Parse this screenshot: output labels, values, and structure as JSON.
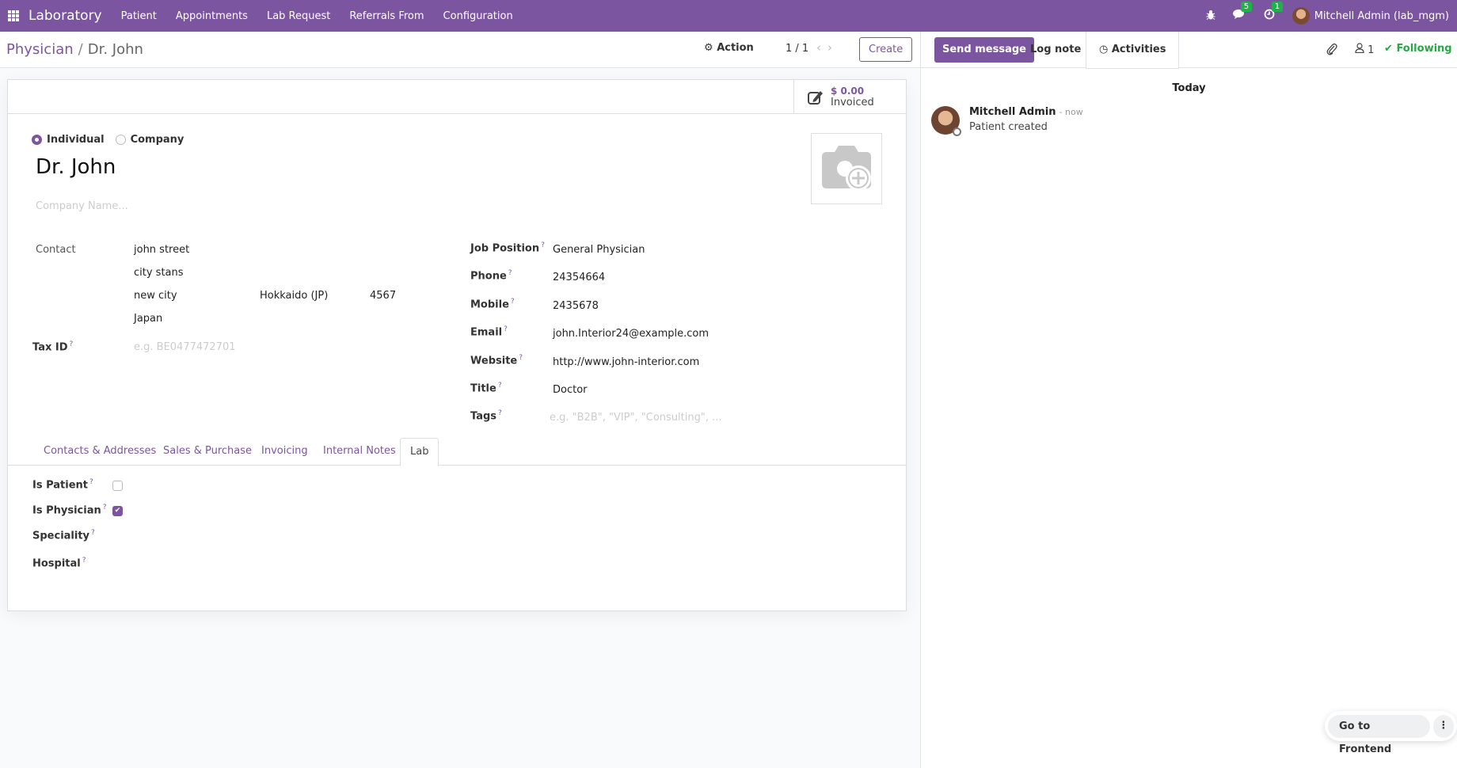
{
  "navbar": {
    "app_name": "Laboratory",
    "menu": [
      "Patient",
      "Appointments",
      "Lab Request",
      "Referrals From",
      "Configuration"
    ],
    "messages_count": "5",
    "activities_count": "1",
    "user": "Mitchell Admin (lab_mgm)",
    "accent_color": "#7c55a0"
  },
  "control_panel": {
    "breadcrumb_parent": "Physician",
    "breadcrumb_separator": "/",
    "breadcrumb_current": "Dr. John",
    "action_label": "Action",
    "pager": "1 / 1",
    "create_label": "Create"
  },
  "stat": {
    "value": "$ 0.00",
    "label": "Invoiced"
  },
  "form": {
    "company_type_options": [
      "Individual",
      "Company"
    ],
    "company_type_selected": "Individual",
    "name": "Dr. John",
    "company_name_placeholder": "Company Name...",
    "contact_label": "Contact",
    "address": {
      "street": "john street",
      "street2": "city stans",
      "city": "new city",
      "state": "Hokkaido (JP)",
      "zip": "4567",
      "country": "Japan"
    },
    "tax_id_label": "Tax ID",
    "tax_id_placeholder": "e.g. BE0477472701",
    "right_fields": [
      {
        "label": "Job Position",
        "value": "General Physician"
      },
      {
        "label": "Phone",
        "value": "24354664"
      },
      {
        "label": "Mobile",
        "value": "2435678"
      },
      {
        "label": "Email",
        "value": "john.Interior24@example.com"
      },
      {
        "label": "Website",
        "value": "http://www.john-interior.com"
      },
      {
        "label": "Title",
        "value": "Doctor"
      },
      {
        "label": "Tags",
        "placeholder": "e.g. \"B2B\", \"VIP\", \"Consulting\", ..."
      }
    ],
    "help_mark": "?",
    "tabs": [
      "Contacts & Addresses",
      "Sales & Purchase",
      "Invoicing",
      "Internal Notes",
      "Lab"
    ],
    "active_tab": "Lab",
    "lab": {
      "is_patient_label": "Is Patient",
      "is_patient": false,
      "is_physician_label": "Is Physician",
      "is_physician": true,
      "speciality_label": "Speciality",
      "hospital_label": "Hospital"
    }
  },
  "chatter": {
    "send_message": "Send message",
    "log_note": "Log note",
    "activities": "Activities",
    "followers_count": "1",
    "following": "Following",
    "day": "Today",
    "messages": [
      {
        "author": "Mitchell Admin",
        "date": "- now",
        "body": "Patient created"
      }
    ]
  },
  "frontend": {
    "label": "Go to Frontend",
    "more": "⋮"
  }
}
